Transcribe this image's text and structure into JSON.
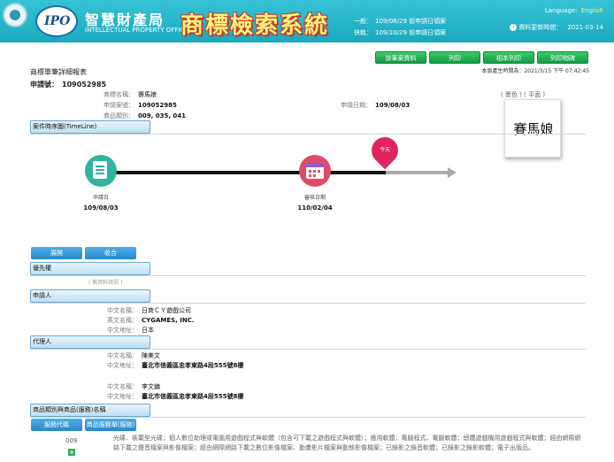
{
  "header": {
    "org_cn": "智慧財產局",
    "org_en": "INTELLECTUAL PROPERTY OFFICE",
    "logo_text": "IPO",
    "system_title": "商標檢索系統",
    "notices": [
      {
        "label": "一般：",
        "text": "109/08/29 前申請日領案"
      },
      {
        "label": "快軌：",
        "text": "109/10/29 前申請日領案"
      }
    ],
    "language_label": "Language:",
    "language_value": "English",
    "update_label": "資料更新時間：",
    "update_value": "2021-03-14"
  },
  "toolbar": {
    "buttons": [
      "該筆案資料",
      "列印",
      "相本列印",
      "列印物碑"
    ],
    "generated": "本頁產生時間為：2021/3/15 下午 07:42:45"
  },
  "page": {
    "title": "商標單筆詳細報表",
    "appno_label": "申請號：",
    "appno_value": "109052985"
  },
  "basic": {
    "name_label": "商標名稱：",
    "name_value": "賽馬娘",
    "app_label": "申請案號：",
    "app_value": "109052985",
    "date_label": "申請日期：",
    "date_value": "109/08/03",
    "class_label": "商品類別：",
    "class_value": "009, 035, 041"
  },
  "image_box": {
    "caption": "( 墨色 ) ( 平面 )",
    "text": "賽馬娘"
  },
  "sections": {
    "timeline": "案件時序圖(TimeLine)",
    "priority": "優先權",
    "applicant": "申請人",
    "agent": "代理人",
    "goods": "商品類別與商品(服務)名稱"
  },
  "timeline": {
    "pin_label": "今天",
    "events": [
      {
        "label": "申請日",
        "date": "109/08/03"
      },
      {
        "label": "審核日期",
        "date": "110/02/04"
      }
    ]
  },
  "tabs": [
    "展開",
    "收合"
  ],
  "priority_note": "( 無資料資訊 )",
  "applicant": {
    "cn_name_label": "中文名稱：",
    "cn_name": "日商ＣＹ遊戲公司",
    "en_name_label": "英文名稱：",
    "en_name": "CYGAMES, INC.",
    "addr_label": "中文地址：",
    "addr": "日本"
  },
  "agents": [
    {
      "name_label": "中文名稱：",
      "name": "陳美文",
      "addr_label": "中文地址：",
      "addr": "臺北市信義區忠孝東路4段555號8樓"
    },
    {
      "name_label": "中文名稱：",
      "name": "李文鎮",
      "addr_label": "中文地址：",
      "addr": "臺北市信義區忠孝東路4段555號8樓"
    }
  ],
  "goods": {
    "tab1": "服務代碼",
    "tab2": "商品服務單(服務)",
    "code": "009",
    "add_label": "+",
    "text": "光碟、裝載型光碟；個人數位助理或電腦用遊戲程式與軟體（包含可下載之遊戲程式與軟體）；應用軟體；電腦程式、電腦軟體；總體遊戲機用遊戲程式與軟體；經由網際網路下載之聲音檔案與影像檔案；經由網際網路下載之數位影像檔案、動畫影片檔案與動態影像檔案；已錄影之錄音軟體；已錄影之錄影軟體；電子出版品。"
  }
}
